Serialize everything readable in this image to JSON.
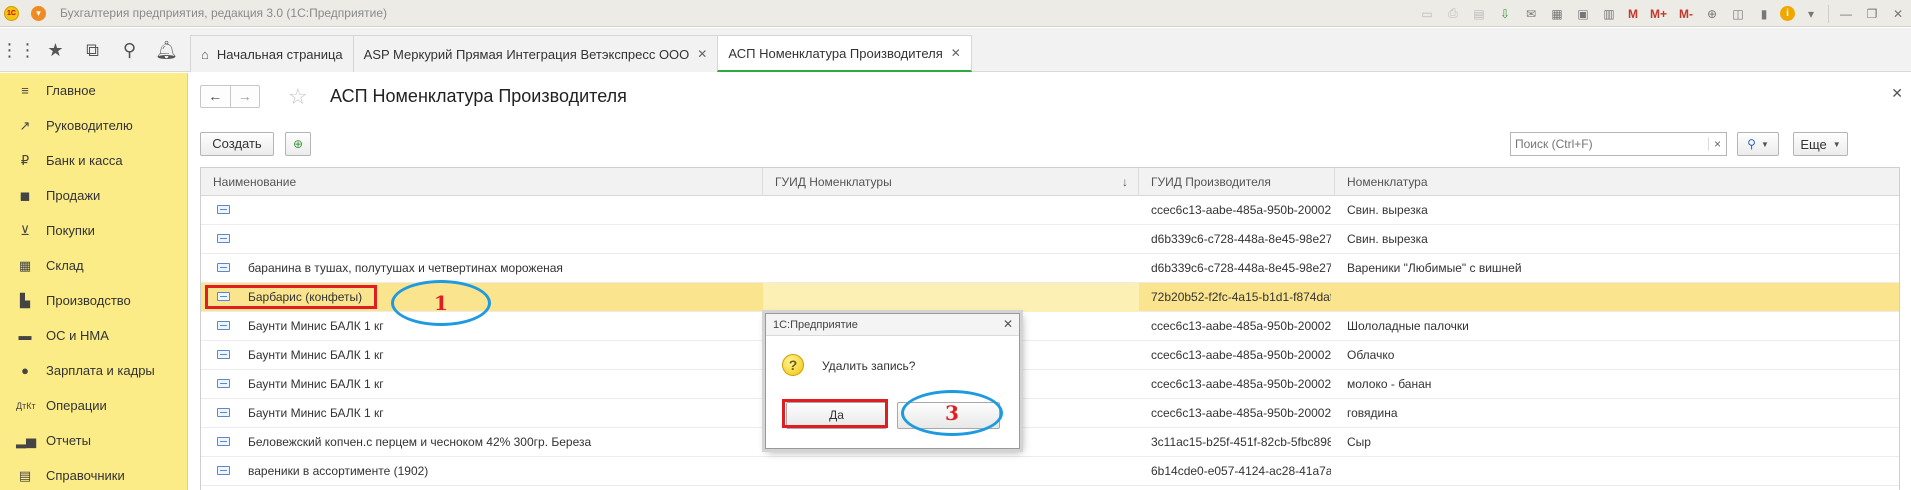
{
  "window": {
    "title": "Бухгалтерия предприятия, редакция 3.0  (1С:Предприятие)",
    "logo": "1С"
  },
  "toolbar": {
    "m_labels": [
      "M",
      "M+",
      "M-"
    ]
  },
  "tabs": [
    {
      "label": "Начальная страница",
      "active": false
    },
    {
      "label": "ASP Меркурий Прямая Интеграция Ветэкспресс ООО",
      "active": false
    },
    {
      "label": "АСП Номенклатура Производителя",
      "active": true
    }
  ],
  "sidebar": {
    "items": [
      {
        "label": "Главное",
        "icon": "menu-icon"
      },
      {
        "label": "Руководителю",
        "icon": "trend-icon"
      },
      {
        "label": "Банк и касса",
        "icon": "ruble-icon"
      },
      {
        "label": "Продажи",
        "icon": "bag-icon"
      },
      {
        "label": "Покупки",
        "icon": "cart-icon"
      },
      {
        "label": "Склад",
        "icon": "warehouse-icon"
      },
      {
        "label": "Производство",
        "icon": "factory-icon"
      },
      {
        "label": "ОС и НМА",
        "icon": "truck-icon"
      },
      {
        "label": "Зарплата и кадры",
        "icon": "person-icon"
      },
      {
        "label": "Операции",
        "icon": "dtkt-icon"
      },
      {
        "label": "Отчеты",
        "icon": "bar-chart-icon"
      },
      {
        "label": "Справочники",
        "icon": "book-icon"
      }
    ]
  },
  "form": {
    "title": "АСП Номенклатура Производителя",
    "create_label": "Создать",
    "search_placeholder": "Поиск (Ctrl+F)",
    "more_label": "Еще",
    "clear_glyph": "×"
  },
  "table": {
    "columns": [
      "Наименование",
      "ГУИД Номенклатуры",
      "ГУИД Производителя",
      "Номенклатура"
    ],
    "sort_indicator": "↓",
    "rows": [
      {
        "name": "",
        "guid_n": "",
        "guid_p": "ccec6c13-aabe-485a-950b-20002...",
        "nomen": "Свин. вырезка",
        "selected": false
      },
      {
        "name": "",
        "guid_n": "",
        "guid_p": "d6b339c6-c728-448a-8e45-98e27...",
        "nomen": "Свин. вырезка",
        "selected": false
      },
      {
        "name": "баранина в тушах, полутушах и четвертинах мороженая",
        "guid_n": "",
        "guid_p": "d6b339c6-c728-448a-8e45-98e27...",
        "nomen": "Вареники \"Любимые\" с вишней",
        "selected": false
      },
      {
        "name": "Барбарис (конфеты)",
        "guid_n": "",
        "guid_p": "72b20b52-f2fc-4a15-b1d1-f874daf...",
        "nomen": "",
        "selected": true
      },
      {
        "name": "Баунти Минис БАЛК 1 кг",
        "guid_n": "",
        "guid_p": "ccec6c13-aabe-485a-950b-20002...",
        "nomen": "Шололадные палочки",
        "selected": false
      },
      {
        "name": "Баунти Минис БАЛК 1 кг",
        "guid_n": "",
        "guid_p": "ccec6c13-aabe-485a-950b-20002...",
        "nomen": "Облачко",
        "selected": false
      },
      {
        "name": "Баунти Минис БАЛК 1 кг",
        "guid_n": "",
        "guid_p": "ccec6c13-aabe-485a-950b-20002...",
        "nomen": "молоко - банан",
        "selected": false
      },
      {
        "name": "Баунти Минис БАЛК 1 кг",
        "guid_n": "",
        "guid_p": "ccec6c13-aabe-485a-950b-20002...",
        "nomen": "говядина",
        "selected": false
      },
      {
        "name": "Беловежский копчен.с перцем и чесноком 42% 300гр. Береза",
        "guid_n": "",
        "guid_p": "3c11ac15-b25f-451f-82cb-5fbc898...",
        "nomen": "Сыр",
        "selected": false
      },
      {
        "name": "вареники в ассортименте (1902)",
        "guid_n": "",
        "guid_p": "6b14cde0-e057-4124-ac28-41a7a...",
        "nomen": "",
        "selected": false
      }
    ]
  },
  "dialog": {
    "title": "1С:Предприятие",
    "message": "Удалить запись?",
    "yes_label": "Да",
    "no_label": ""
  },
  "annotations": {
    "marker_1": "1",
    "marker_3": "3"
  },
  "colors": {
    "sidebar_bg": "#fbec88",
    "selected_row": "#fae48d",
    "active_tab_accent": "#2eaa3e",
    "annotation_red": "#e01e22",
    "annotation_blue": "#1e9be0"
  }
}
